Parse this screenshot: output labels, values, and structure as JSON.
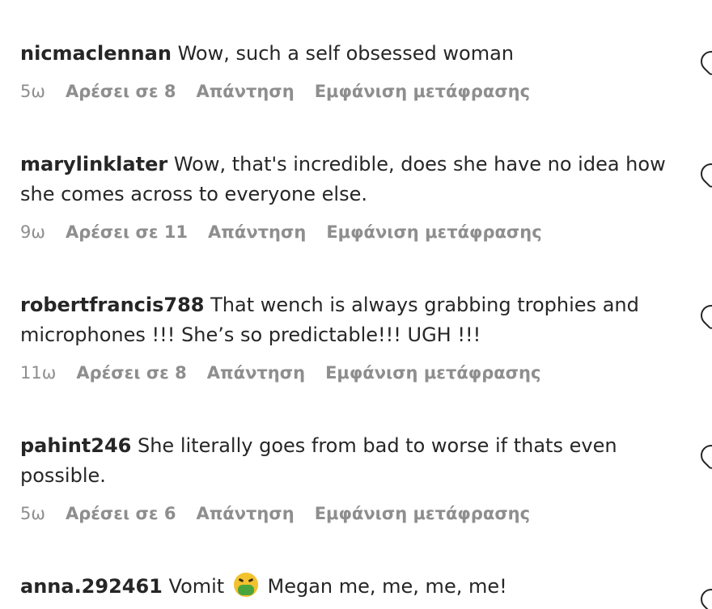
{
  "comments": [
    {
      "username": "nicmaclennan",
      "text": "Wow, such a self obsessed woman",
      "age": "5ω",
      "likes": "Αρέσει σε 8",
      "reply": "Απάντηση",
      "translate": "Εμφάνιση μετάφρασης"
    },
    {
      "username": "marylinklater",
      "text": "Wow, that's incredible, does she have no idea how she comes across to everyone else.",
      "age": "9ω",
      "likes": "Αρέσει σε 11",
      "reply": "Απάντηση",
      "translate": "Εμφάνιση μετάφρασης"
    },
    {
      "username": "robertfrancis788",
      "text": "That wench is always grabbing trophies and microphones !!! She’s so predictable!!! UGH !!!",
      "age": "11ω",
      "likes": "Αρέσει σε 8",
      "reply": "Απάντηση",
      "translate": "Εμφάνιση μετάφρασης"
    },
    {
      "username": "pahint246",
      "text": "She literally goes from bad to worse if thats even possible.",
      "age": "5ω",
      "likes": "Αρέσει σε 6",
      "reply": "Απάντηση",
      "translate": "Εμφάνιση μετάφρασης"
    },
    {
      "username": "anna.292461",
      "text_before_emoji": "Vomit",
      "emoji": "nauseated-face-emoji",
      "text_after_emoji": "Megan me, me, me, me!"
    }
  ],
  "icons": {
    "like": "heart-outline-icon"
  }
}
